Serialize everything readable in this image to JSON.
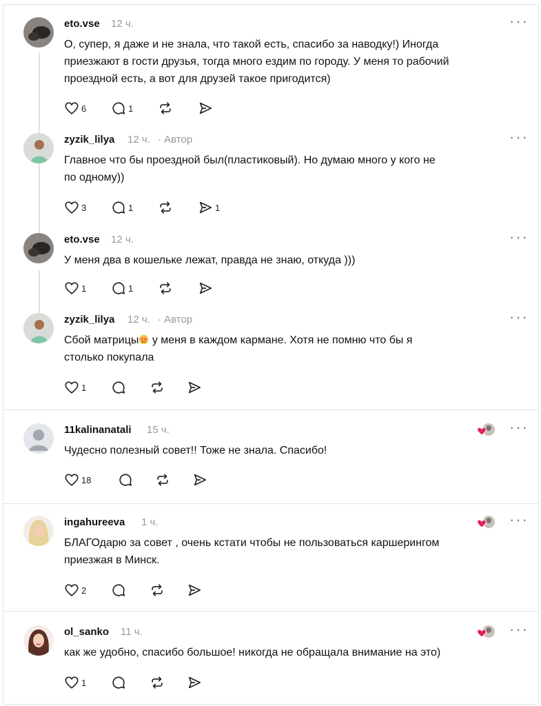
{
  "posts": [
    {
      "username": "eto.vse",
      "time": "12 ч.",
      "author_tag": "",
      "lines": [
        "О, супер, я даже и не знала, что такой есть, спасибо за наводку!) Иногда",
        "приезжают в гости друзья, тогда много ездим по городу. У меня то рабочий",
        "проездной есть, а вот для друзей такое пригодится)"
      ],
      "likes": "6",
      "replies": "1",
      "shares": ""
    },
    {
      "username": "zyzik_lilya",
      "time": "12 ч.",
      "author_tag": "· Автор",
      "lines": [
        "Главное что бы проездной был(пластиковый). Но думаю много у кого не",
        "по одному))"
      ],
      "likes": "3",
      "replies": "1",
      "shares": "1"
    },
    {
      "username": "eto.vse",
      "time": "12 ч.",
      "author_tag": "",
      "lines": [
        "У меня два в кошельке лежат, правда не знаю, откуда )))"
      ],
      "likes": "1",
      "replies": "1",
      "shares": ""
    },
    {
      "username": "zyzik_lilya",
      "time": "12 ч.",
      "author_tag": "· Автор",
      "line_a_before": "Сбой матрицы",
      "line_a_after": "у меня в каждом кармане. Хотя не помню что бы я",
      "lines": [
        "столько покупала"
      ],
      "likes": "1",
      "replies": "",
      "shares": ""
    },
    {
      "username": "11kalinanatali",
      "time": "15 ч.",
      "author_tag": "",
      "lines": [
        "Чудесно полезный совет!! Тоже не знала. Спасибо!"
      ],
      "likes": "18",
      "replies": "",
      "shares": ""
    },
    {
      "username": "ingahureeva",
      "time": "1 ч.",
      "author_tag": "",
      "lines": [
        "БЛАГОдарю за совет , очень кстати чтобы не пользоваться каршерингом",
        "приезжая в Минск."
      ],
      "likes": "2",
      "replies": "",
      "shares": ""
    },
    {
      "username": "ol_sanko",
      "time": "11 ч.",
      "author_tag": "",
      "lines": [
        "как же удобно, спасибо большое! никогда не обращала внимание на это)"
      ],
      "likes": "1",
      "replies": "",
      "shares": ""
    }
  ],
  "menu_dots": "···",
  "icons": {
    "like": "heart-icon",
    "reply": "comment-icon",
    "repost": "repost-icon",
    "share": "send-icon",
    "liked_by_author": "liked-by-author-badge",
    "more": "more-options-icon"
  },
  "colors": {
    "text": "#111111",
    "muted": "#999999",
    "icon": "#222222",
    "heart_red": "#e0245e",
    "separator": "#e4e4e4"
  }
}
